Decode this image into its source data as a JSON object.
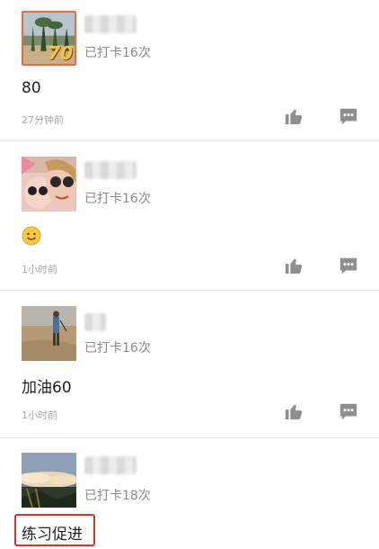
{
  "posts": [
    {
      "checkin_text": "已打卡16次",
      "content": "80",
      "time": "27分钟前",
      "avatar_badge": "70",
      "like_icon": "thumbs-up-icon",
      "comment_icon": "comment-icon"
    },
    {
      "checkin_text": "已打卡16次",
      "content": "",
      "content_emoji": "🙂",
      "time": "1小时前",
      "like_icon": "thumbs-up-icon",
      "comment_icon": "comment-icon"
    },
    {
      "checkin_text": "已打卡16次",
      "content": "加油60",
      "time": "1小时前",
      "like_icon": "thumbs-up-icon",
      "comment_icon": "comment-icon"
    },
    {
      "checkin_text": "已打卡18次",
      "content": "练习促进",
      "highlighted": true
    }
  ],
  "colors": {
    "icon_gray": "#8f8f8f",
    "highlight_red": "#e03030",
    "divider": "#e4e4e4"
  }
}
